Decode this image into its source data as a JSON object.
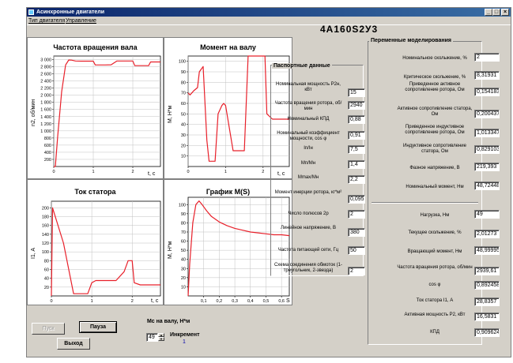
{
  "window": {
    "title": "Асинхронные двигатели",
    "minimize": "_",
    "maximize": "□",
    "close": "×"
  },
  "menu": [
    "Тип двигателя",
    "Управление"
  ],
  "motor_title": "4A160S2У3",
  "colors": {
    "curve": "#e8202a",
    "window_bg": "#d4d0c8",
    "titlebar": "#0a246a"
  },
  "chart_data": [
    {
      "type": "line",
      "title": "Частота вращения вала",
      "ylabel": "n2, об/мин",
      "xlabel": "t, c",
      "xlim": [
        0,
        2.7
      ],
      "ylim": [
        0,
        3100
      ],
      "xticks": [
        "0",
        "1",
        "2"
      ],
      "yticks": [
        "200",
        "400",
        "600",
        "800",
        "1 000",
        "1 200",
        "1 400",
        "1 600",
        "1 800",
        "2 000",
        "2 200",
        "2 400",
        "2 600",
        "2 800",
        "3 000"
      ],
      "ytick_values": [
        200,
        400,
        600,
        800,
        1000,
        1200,
        1400,
        1600,
        1800,
        2000,
        2200,
        2400,
        2600,
        2800,
        3000
      ],
      "x": [
        0.0,
        0.04,
        0.1,
        0.2,
        0.3,
        0.38,
        0.45,
        0.55,
        0.7,
        1.0,
        1.05,
        1.3,
        1.45,
        1.6,
        1.65,
        1.9,
        2.0,
        2.05,
        2.3,
        2.4,
        2.45,
        2.7
      ],
      "y": [
        0,
        0,
        850,
        2100,
        2850,
        2990,
        2985,
        2960,
        2955,
        2955,
        2850,
        2850,
        2855,
        2960,
        2960,
        2960,
        2960,
        2830,
        2830,
        2830,
        2935,
        2935
      ]
    },
    {
      "type": "line",
      "title": "Момент на валу",
      "ylabel": "M, H*м",
      "xlabel": "t, c",
      "xlim": [
        0,
        2.7
      ],
      "ylim": [
        0,
        105
      ],
      "xticks": [
        "0",
        "1",
        "2"
      ],
      "yticks": [
        "10",
        "20",
        "30",
        "40",
        "50",
        "60",
        "70",
        "80",
        "90",
        "100"
      ],
      "ytick_values": [
        10,
        20,
        30,
        40,
        50,
        60,
        70,
        80,
        90,
        100
      ],
      "x": [
        0.0,
        0.05,
        0.15,
        0.25,
        0.3,
        0.4,
        0.5,
        0.56,
        0.62,
        0.72,
        0.8,
        0.9,
        0.95,
        1.0,
        1.2,
        1.3,
        1.4,
        1.5,
        1.6,
        1.9,
        2.0,
        2.05,
        2.1,
        2.25,
        2.6,
        2.7
      ],
      "y": [
        70,
        68,
        72,
        75,
        90,
        95,
        25,
        5,
        5,
        5,
        50,
        58,
        60,
        58,
        15,
        15,
        15,
        15,
        105,
        105,
        105,
        105,
        50,
        45,
        45,
        45
      ]
    },
    {
      "type": "line",
      "title": "Ток статора",
      "ylabel": "I1, A",
      "xlabel": "t, c",
      "xlim": [
        0,
        2.7
      ],
      "ylim": [
        0,
        215
      ],
      "xticks": [
        "0",
        "1",
        "2"
      ],
      "yticks": [
        "20",
        "40",
        "60",
        "80",
        "100",
        "120",
        "140",
        "160",
        "180",
        "200"
      ],
      "ytick_values": [
        20,
        40,
        60,
        80,
        100,
        120,
        140,
        160,
        180,
        200
      ],
      "x": [
        0.0,
        0.03,
        0.3,
        0.55,
        0.65,
        0.75,
        0.9,
        1.0,
        1.1,
        1.3,
        1.45,
        1.6,
        1.8,
        1.9,
        2.0,
        2.05,
        2.2,
        2.45,
        2.7
      ],
      "y": [
        0,
        200,
        120,
        5,
        5,
        5,
        5,
        30,
        35,
        35,
        35,
        35,
        55,
        80,
        80,
        30,
        25,
        25,
        25
      ]
    },
    {
      "type": "line",
      "title": "График M(S)",
      "ylabel": "M, H*м",
      "xlabel": "S",
      "xlim": [
        0,
        0.65
      ],
      "ylim": [
        0,
        108
      ],
      "xticks": [
        "0,1",
        "0,2",
        "0,3",
        "0,4",
        "0,5",
        "0,6"
      ],
      "xtick_values": [
        0.1,
        0.2,
        0.3,
        0.4,
        0.5,
        0.6
      ],
      "yticks": [
        "10",
        "20",
        "30",
        "40",
        "50",
        "60",
        "70",
        "80",
        "90",
        "100"
      ],
      "ytick_values": [
        10,
        20,
        30,
        40,
        50,
        60,
        70,
        80,
        90,
        100
      ],
      "x": [
        0.0,
        0.01,
        0.03,
        0.05,
        0.07,
        0.09,
        0.12,
        0.15,
        0.2,
        0.25,
        0.3,
        0.35,
        0.4,
        0.45,
        0.5,
        0.55,
        0.6,
        0.65
      ],
      "y": [
        0,
        35,
        80,
        100,
        104,
        100,
        93,
        87,
        81,
        77,
        74,
        72,
        70,
        69,
        68,
        67,
        67,
        66
      ]
    }
  ],
  "passport": {
    "heading": "Паспортные данные",
    "fields": [
      {
        "label": "Номинальная мощность P2н, кВт",
        "value": "15"
      },
      {
        "label": "Частота вращения ротора, об/мин",
        "value": "2940"
      },
      {
        "label": "Номинальный КПД",
        "value": "0,88"
      },
      {
        "label": "Номинальный коэффициент мощности, cos φ",
        "value": "0,91"
      },
      {
        "label": "Iп/Iн",
        "value": "7,5"
      },
      {
        "label": "Mп/Mн",
        "value": "1,4"
      },
      {
        "label": "Mmax/Mн",
        "value": "2,2"
      },
      {
        "label": "Момент инерции ротора, кг*м²",
        "value": "0,095"
      },
      {
        "label": "Число полюсов 2p",
        "value": "2"
      },
      {
        "label": "Линейное напряжение, В",
        "value": "380"
      },
      {
        "label": "Частота питающей сети, Гц",
        "value": "50"
      },
      {
        "label": "Схема соединения обмоток (1-треугольник, 2-звезда)",
        "value": "2"
      }
    ]
  },
  "vars": {
    "heading": "Переменные моделирования",
    "fields": [
      {
        "label": "Номинальное скольжение, %",
        "value": "2"
      },
      {
        "label": "Критическое скольжение, %",
        "value": "8,31931"
      },
      {
        "label": "Приведенное активное сопротивление ротора, Ом",
        "value": "0,154183"
      },
      {
        "label": "Активное сопротивление статора, Ом",
        "value": "0,200437"
      },
      {
        "label": "Приведенное индуктивное сопротивление ротора, Ом",
        "value": "1,013347"
      },
      {
        "label": "Индуктивное сопротивление статора, Ом",
        "value": "0,829103"
      },
      {
        "label": "Фазное напряжение, В",
        "value": "219,393"
      },
      {
        "label": "Номинальный момент, Нм",
        "value": "48,72448"
      },
      {
        "label": "Нагрузка, Нм",
        "value": "49"
      },
      {
        "label": "Текущее скольжение, %",
        "value": "2,01273"
      },
      {
        "label": "Вращающий момент, Нм",
        "value": "48,99995"
      },
      {
        "label": "Частота вращения ротора, об/мин",
        "value": "2939,61"
      },
      {
        "label": "cos φ",
        "value": "0,892458"
      },
      {
        "label": "Ток статора I1, А",
        "value": "28,8357"
      },
      {
        "label": "Активная мощность P2, кВт",
        "value": "16,5831"
      },
      {
        "label": "КПД",
        "value": "0,909624"
      }
    ]
  },
  "buttons": {
    "start": "Пуск",
    "pause": "Пауза",
    "exit": "Выход"
  },
  "mc": {
    "label": "Мс на валу, Н*м",
    "value": "49",
    "inc_label": "Инкремент",
    "inc_value": "1"
  }
}
